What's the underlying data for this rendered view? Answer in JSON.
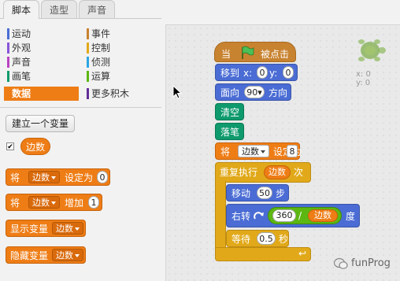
{
  "tabs": [
    "脚本",
    "造型",
    "声音"
  ],
  "categories_left": [
    {
      "label": "运动",
      "color": "#4a6cd4"
    },
    {
      "label": "外观",
      "color": "#8a55d7"
    },
    {
      "label": "声音",
      "color": "#bb42c3"
    },
    {
      "label": "画笔",
      "color": "#0e9a6c"
    },
    {
      "label": "数据",
      "color": "#ee7d16"
    }
  ],
  "categories_right": [
    {
      "label": "事件",
      "color": "#c88330"
    },
    {
      "label": "控制",
      "color": "#e1a91a"
    },
    {
      "label": "侦测",
      "color": "#2ca5e2"
    },
    {
      "label": "运算",
      "color": "#5cb712"
    },
    {
      "label": "更多积木",
      "color": "#632d99"
    }
  ],
  "palette": {
    "make_variable_button": "建立一个变量",
    "checkbox_mark": "✔",
    "variable_name": "边数",
    "blocks": {
      "set_prefix": "将",
      "set_var": "边数",
      "set_mid": "设定为",
      "set_value": "0",
      "change_prefix": "将",
      "change_var": "边数",
      "change_mid": "增加",
      "change_value": "1",
      "show_label": "显示变量",
      "show_var": "边数",
      "hide_label": "隐藏变量",
      "hide_var": "边数"
    }
  },
  "script": {
    "when_flag_prefix": "当",
    "when_flag_suffix": "被点击",
    "goto_label": "移到",
    "goto_x_label": "x:",
    "goto_x": "0",
    "goto_y_label": "y:",
    "goto_y": "0",
    "point_label": "面向",
    "point_value": "90▾",
    "point_suffix": "方向",
    "clear_label": "清空",
    "pendown_label": "落笔",
    "set_prefix": "将",
    "set_var": "边数",
    "set_mid": "设定为",
    "set_value": "8",
    "repeat_label": "重复执行",
    "repeat_var": "边数",
    "repeat_suffix": "次",
    "move_label": "移动",
    "move_value": "50",
    "move_suffix": "步",
    "turn_label": "右转",
    "turn_num": "360",
    "turn_op": "/",
    "turn_var": "边数",
    "turn_suffix": "度",
    "wait_label": "等待",
    "wait_value": "0.5",
    "wait_suffix": "秒",
    "loop_arrow": "↩"
  },
  "sprite": {
    "x_label": "x: 0",
    "y_label": "y: 0"
  },
  "watermark": "funProg"
}
